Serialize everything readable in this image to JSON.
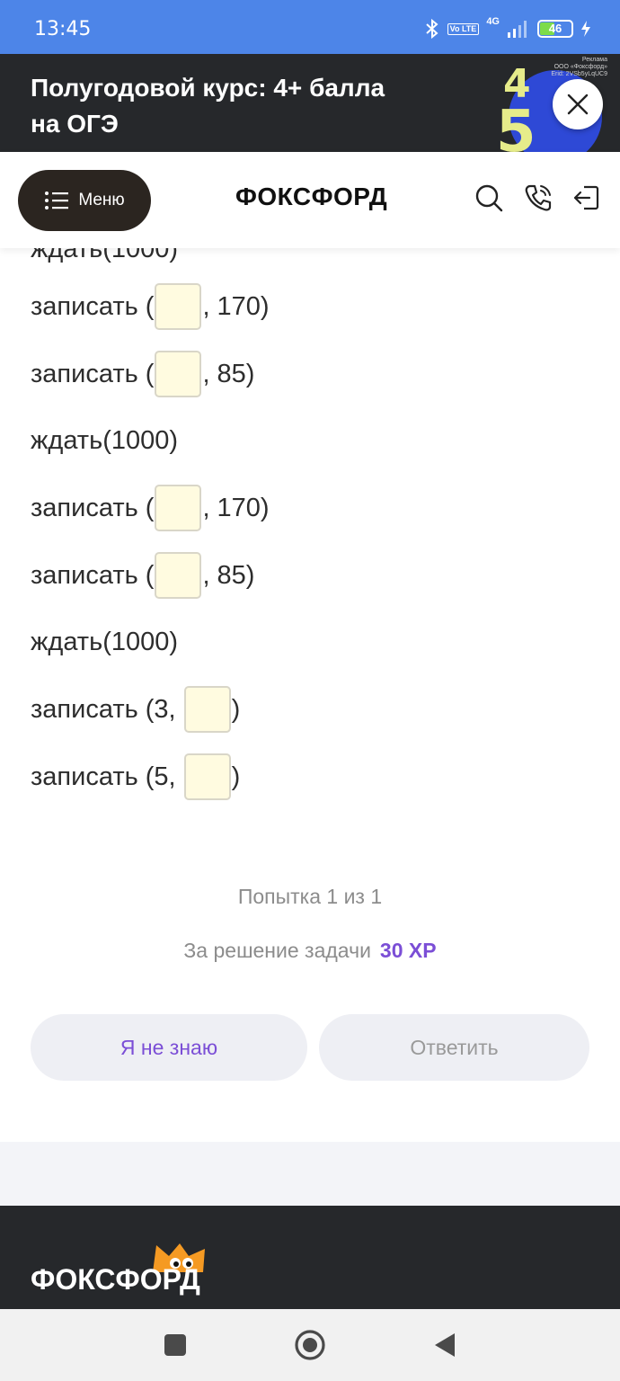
{
  "status_bar": {
    "time": "13:45",
    "network_tag": "Vo LTE",
    "network_type": "4G",
    "battery_level": "46",
    "battery_fraction": 0.46
  },
  "ad_banner": {
    "title": "Полугодовой курс: 4+ балла на ОГЭ",
    "legal_label": "Реклама",
    "legal_company": "ООО «Фоксфорд»",
    "legal_erid": "Erid: 2VSb5yLqUC9",
    "art_digits": [
      "4",
      "5"
    ],
    "accent_color": "#e6ec8a",
    "art_color": "#2e49d6"
  },
  "header": {
    "menu_label": "Меню",
    "logo_text": "ФОКСФОРД",
    "icons": [
      "search-icon",
      "phone-icon",
      "logout-icon"
    ]
  },
  "task_lines": [
    {
      "prefix": "записать (",
      "suffix": ", 170)",
      "blank": "first"
    },
    {
      "prefix": "записать (",
      "suffix": ", 85)",
      "blank": "first"
    },
    {
      "text": "ждать(1000)"
    },
    {
      "prefix": "записать (",
      "suffix": ", 170)",
      "blank": "first"
    },
    {
      "prefix": "записать (",
      "suffix": ", 85)",
      "blank": "first"
    },
    {
      "text": "ждать(1000)"
    },
    {
      "prefix": "записать (3, ",
      "suffix": ")",
      "blank": "second"
    },
    {
      "prefix": "записать (5, ",
      "suffix": ")",
      "blank": "second"
    }
  ],
  "clipped_line": "ждать(1000)",
  "attempt_text": "Попытка 1 из 1",
  "reward": {
    "label": "За решение задачи",
    "xp": "30 XP",
    "xp_color": "#7b4ed6"
  },
  "buttons": {
    "dont_know": "Я не знаю",
    "answer": "Ответить"
  },
  "footer": {
    "logo_text": "ФОКСФОРД",
    "mascot_color": "#f59a23"
  },
  "nav_bar": {
    "icons": [
      "recent-apps-icon",
      "home-icon",
      "back-icon"
    ]
  }
}
